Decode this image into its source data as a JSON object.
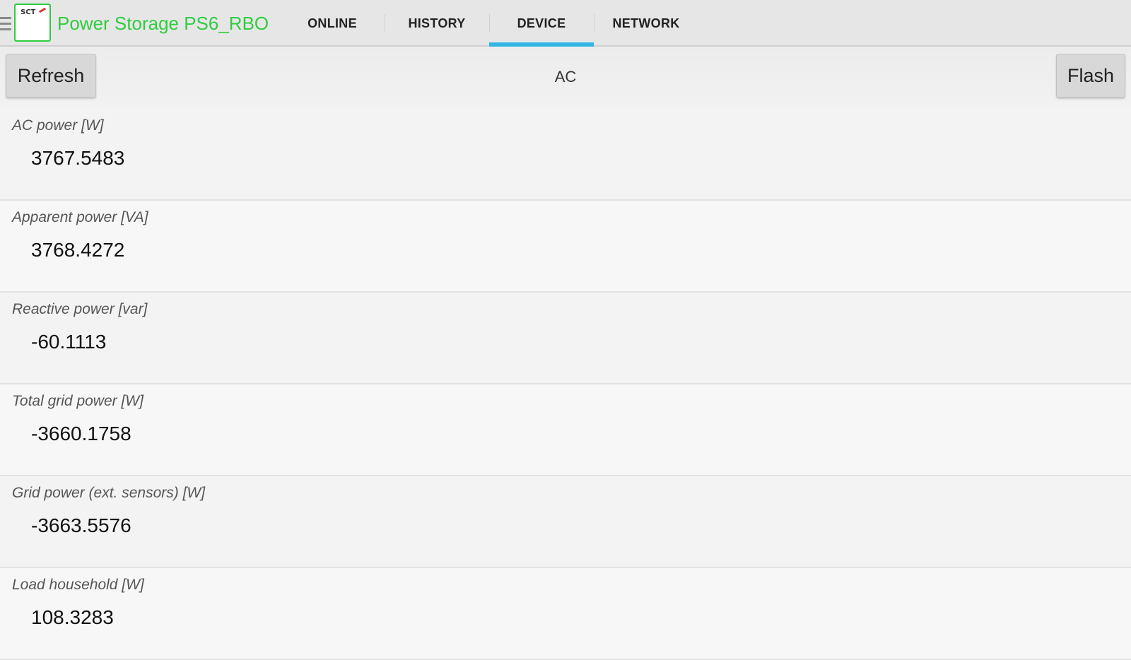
{
  "app": {
    "title": "Power Storage PS6_RBO",
    "logo_text": "SCT",
    "brand_color": "#2fcc3f"
  },
  "tabs": [
    {
      "label": "ONLINE",
      "active": false
    },
    {
      "label": "HISTORY",
      "active": false
    },
    {
      "label": "DEVICE",
      "active": true
    },
    {
      "label": "NETWORK",
      "active": false
    }
  ],
  "accent_color": "#33b5e5",
  "toolbar": {
    "refresh_label": "Refresh",
    "section_title": "AC",
    "flash_label": "Flash"
  },
  "rows": [
    {
      "label": "AC power [W]",
      "value": "3767.5483"
    },
    {
      "label": "Apparent power [VA]",
      "value": "3768.4272"
    },
    {
      "label": "Reactive power [var]",
      "value": "-60.1113"
    },
    {
      "label": "Total grid power [W]",
      "value": "-3660.1758"
    },
    {
      "label": "Grid power (ext. sensors) [W]",
      "value": "-3663.5576"
    },
    {
      "label": "Load household [W]",
      "value": "108.3283"
    }
  ],
  "icons": {
    "drawer": "menu-icon",
    "logo": "app-logo-icon"
  }
}
